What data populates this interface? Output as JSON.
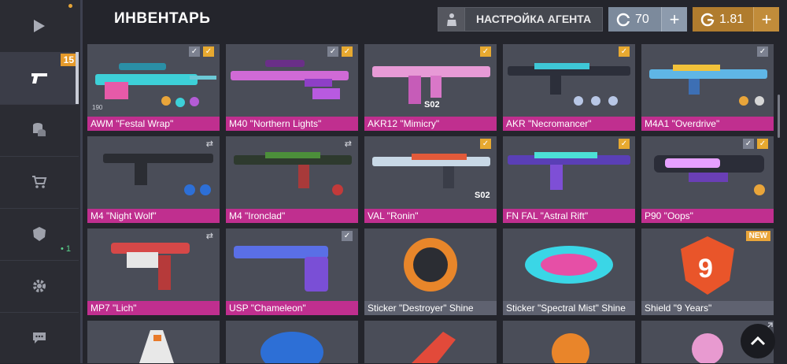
{
  "header": {
    "title": "ИНВЕНТАРЬ",
    "agent_button": "НАСТРОЙКА АГЕНТА",
    "silver_amount": "70",
    "gold_amount": "1.81"
  },
  "sidebar": {
    "items": [
      {
        "icon": "play-icon"
      },
      {
        "icon": "pistol-icon",
        "badge": "15"
      },
      {
        "icon": "coins-icon"
      },
      {
        "icon": "cart-icon"
      },
      {
        "icon": "clan-icon",
        "count": "• 1"
      },
      {
        "icon": "gear-icon"
      },
      {
        "icon": "chat-icon"
      }
    ]
  },
  "items": [
    {
      "name": "AWM \"Festal Wrap\"",
      "count": "190"
    },
    {
      "name": "M40 \"Northern Lights\""
    },
    {
      "name": "AKR12 \"Mimicry\""
    },
    {
      "name": "AKR \"Necromancer\""
    },
    {
      "name": "M4A1 \"Overdrive\""
    },
    {
      "name": "M4 \"Night Wolf\""
    },
    {
      "name": "M4 \"Ironclad\""
    },
    {
      "name": "VAL \"Ronin\""
    },
    {
      "name": "FN FAL \"Astral Rift\""
    },
    {
      "name": "P90 \"Oops\""
    },
    {
      "name": "MP7 \"Lich\""
    },
    {
      "name": "USP \"Chameleon\""
    },
    {
      "name": "Sticker \"Destroyer\" Shine"
    },
    {
      "name": "Sticker \"Spectral Mist\" Shine"
    },
    {
      "name": "Shield \"9 Years\"",
      "badge": "NEW"
    }
  ],
  "colors": {
    "rarity_pink": "#c02f8f",
    "gold": "#b07c2e",
    "silver": "#7c8a9c",
    "check_yellow": "#e7a930"
  }
}
